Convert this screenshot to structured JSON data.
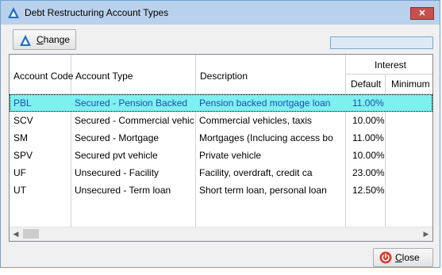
{
  "window": {
    "title": "Debt Restructuring Account Types",
    "close_glyph": "✕"
  },
  "toolbar": {
    "change_prefix": "C",
    "change_rest": "hange"
  },
  "grid": {
    "columns": {
      "code": "Account Code",
      "type": "Account Type",
      "description": "Description",
      "interest": "Interest",
      "default": "Default",
      "minimum": "Minimum"
    },
    "rows": [
      {
        "code": "PBL",
        "type": "Secured - Pension Backed",
        "description": "Pension backed mortgage loan",
        "default": "11.00%",
        "minimum": ""
      },
      {
        "code": "SCV",
        "type": "Secured - Commercial vehicle",
        "description": "Commercial vehicles, taxis",
        "default": "10.00%",
        "minimum": ""
      },
      {
        "code": "SM",
        "type": "Secured - Mortgage",
        "description": "Mortgages (Inclucing access bo",
        "default": "11.00%",
        "minimum": ""
      },
      {
        "code": "SPV",
        "type": "Secured pvt vehicle",
        "description": "Private vehicle",
        "default": "10.00%",
        "minimum": ""
      },
      {
        "code": "UF",
        "type": "Unsecured - Facility",
        "description": "Facility, overdraft, credit ca",
        "default": "23.00%",
        "minimum": ""
      },
      {
        "code": "UT",
        "type": "Unsecured - Term loan",
        "description": "Short term loan, personal loan",
        "default": "12.50%",
        "minimum": ""
      }
    ],
    "selected_row_color": "#7ff0f0"
  },
  "footer": {
    "close_prefix": "C",
    "close_rest": "lose"
  },
  "icons": {
    "app": "app-logo-icon",
    "change": "change-logo-icon",
    "close": "power-icon"
  }
}
